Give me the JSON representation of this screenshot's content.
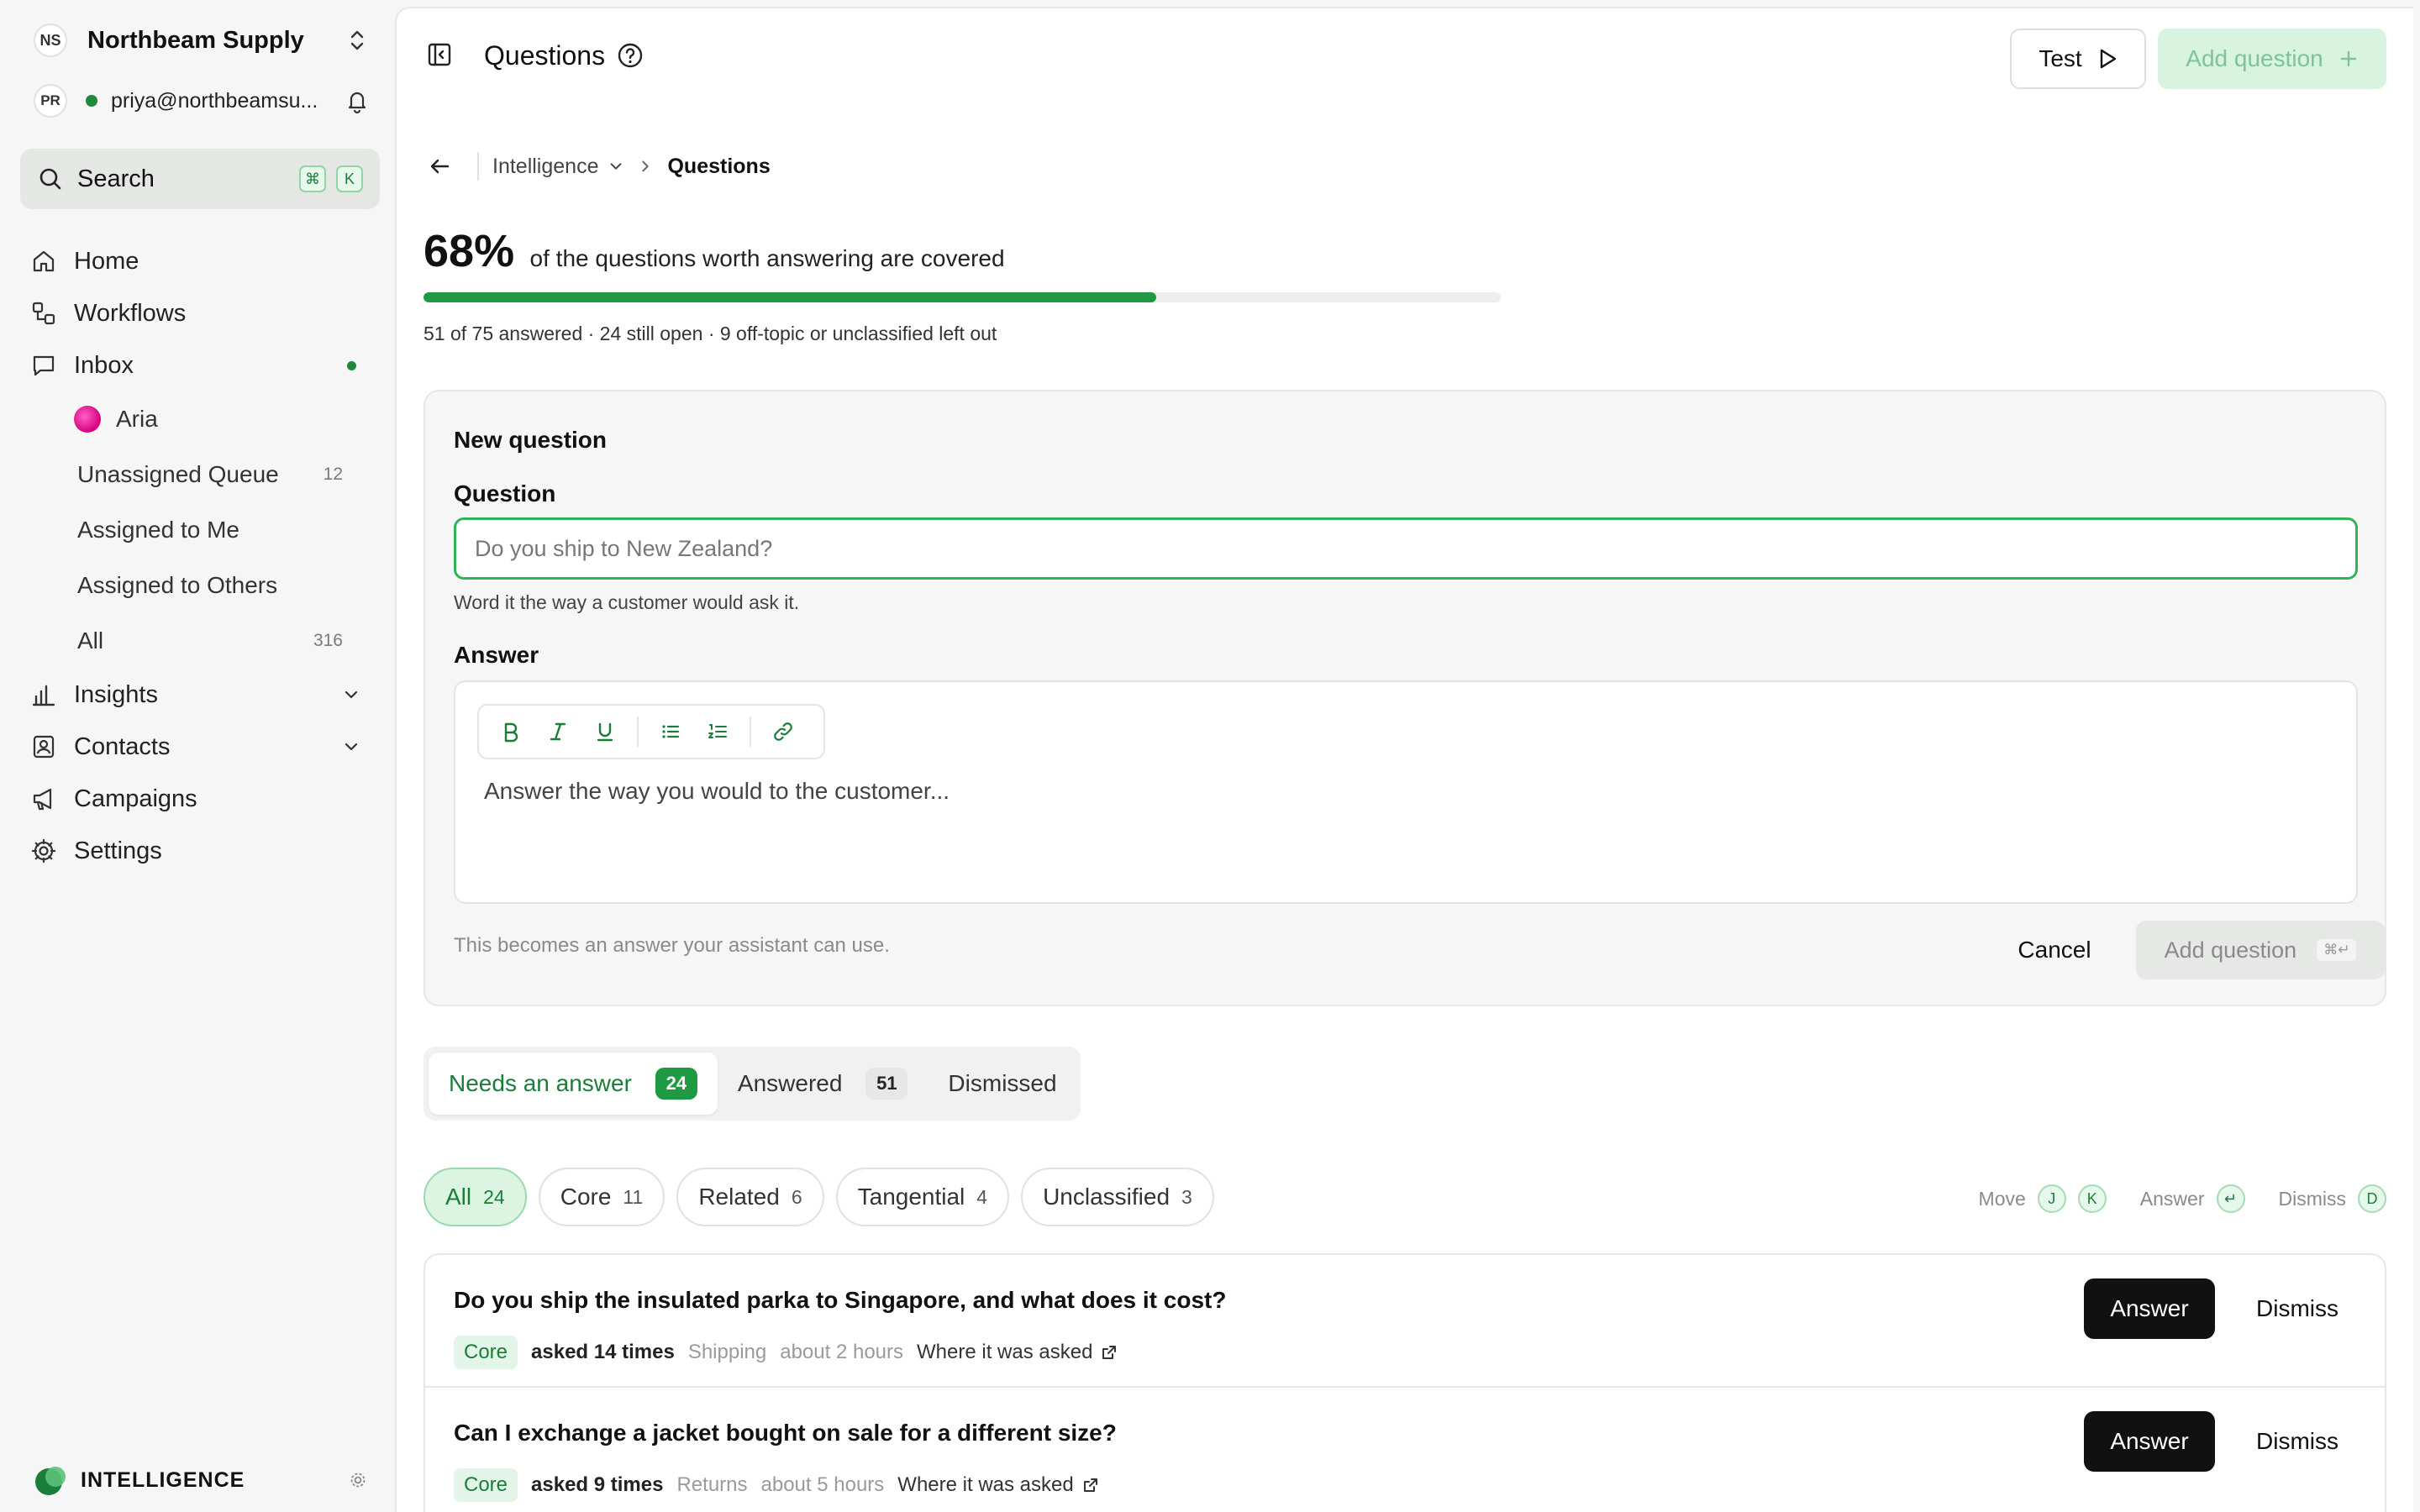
{
  "workspace": {
    "initials": "NS",
    "name": "Northbeam Supply"
  },
  "user": {
    "initials": "PR",
    "email": "priya@northbeamsu..."
  },
  "search": {
    "label": "Search",
    "kbd1": "⌘",
    "kbd2": "K"
  },
  "nav": {
    "home": "Home",
    "workflows": "Workflows",
    "inbox": "Inbox",
    "inbox_sub": [
      {
        "label": "Aria",
        "count": ""
      },
      {
        "label": "Unassigned Queue",
        "count": "12"
      },
      {
        "label": "Assigned to Me",
        "count": ""
      },
      {
        "label": "Assigned to Others",
        "count": ""
      },
      {
        "label": "All",
        "count": "316"
      }
    ],
    "insights": "Insights",
    "contacts": "Contacts",
    "campaigns": "Campaigns",
    "settings": "Settings"
  },
  "footer": {
    "brand": "INTELLIGENCE"
  },
  "header": {
    "title": "Questions",
    "test_label": "Test",
    "add_label": "Add question"
  },
  "breadcrumb": {
    "parent": "Intelligence",
    "current": "Questions"
  },
  "coverage": {
    "percent_label": "68%",
    "percent_value": 0.68,
    "text": "of the questions worth answering are covered",
    "sub": "51 of 75 answered · 24 still open · 9 off-topic or unclassified left out"
  },
  "form": {
    "title": "New question",
    "question_label": "Question",
    "question_placeholder": "Do you ship to New Zealand?",
    "question_hint": "Word it the way a customer would ask it.",
    "answer_label": "Answer",
    "answer_placeholder": "Answer the way you would to the customer...",
    "footnote": "This becomes an answer your assistant can use.",
    "cancel_label": "Cancel",
    "submit_label": "Add question",
    "submit_kbd": "⌘↵"
  },
  "tabs": [
    {
      "label": "Needs an answer",
      "count": "24"
    },
    {
      "label": "Answered",
      "count": "51"
    },
    {
      "label": "Dismissed",
      "count": ""
    }
  ],
  "filters": [
    {
      "label": "All",
      "count": "24"
    },
    {
      "label": "Core",
      "count": "11"
    },
    {
      "label": "Related",
      "count": "6"
    },
    {
      "label": "Tangential",
      "count": "4"
    },
    {
      "label": "Unclassified",
      "count": "3"
    }
  ],
  "shortcuts": {
    "move": "Move",
    "move_k1": "J",
    "move_k2": "K",
    "answer": "Answer",
    "answer_k": "↵",
    "dismiss": "Dismiss",
    "dismiss_k": "D"
  },
  "questions": [
    {
      "text": "Do you ship the insulated parka to Singapore, and what does it cost?",
      "tag": "Core",
      "asked": "asked 14 times",
      "topic": "Shipping",
      "time": "about 2 hours",
      "where": "Where it was asked",
      "answer_label": "Answer",
      "dismiss_label": "Dismiss"
    },
    {
      "text": "Can I exchange a jacket bought on sale for a different size?",
      "tag": "Core",
      "asked": "asked 9 times",
      "topic": "Returns",
      "time": "about 5 hours",
      "where": "Where it was asked",
      "answer_label": "Answer",
      "dismiss_label": "Dismiss"
    }
  ],
  "colors": {
    "accent": "#1f9a42",
    "accent_light": "#dcf5e3",
    "brand_pink": "#d6007f"
  }
}
